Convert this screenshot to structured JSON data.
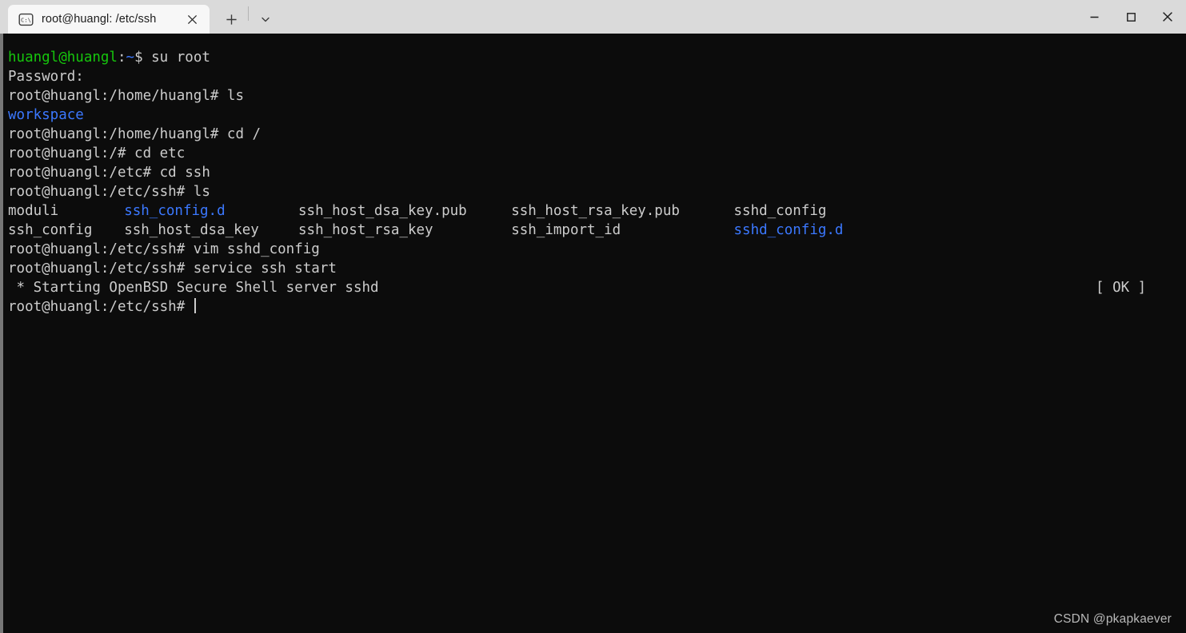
{
  "window": {
    "tab": {
      "title": "root@huangl: /etc/ssh",
      "icon": "command-prompt-icon",
      "close_label": "✕"
    },
    "newtab_label": "+",
    "dropdown_label": "⌄",
    "controls": {
      "minimize": "─",
      "maximize": "□",
      "close": "✕"
    },
    "titlebar_color": "#dadada",
    "tab_active_color": "#f7f7f7"
  },
  "terminal": {
    "background": "#0c0c0c",
    "foreground": "#cccccc",
    "green": "#16c60c",
    "blue": "#3b78ff",
    "lines": {
      "l1_user": "huangl@huangl",
      "l1_colon": ":",
      "l1_tilde": "~",
      "l1_dollar_cmd": "$ su root",
      "l2": "Password:",
      "l3": "root@huangl:/home/huangl# ls",
      "l4_workspace": "workspace",
      "l5": "root@huangl:/home/huangl# cd /",
      "l6": "root@huangl:/# cd etc",
      "l7": "root@huangl:/etc# cd ssh",
      "l8": "root@huangl:/etc/ssh# ls",
      "l11": "root@huangl:/etc/ssh# vim sshd_config",
      "l12": "root@huangl:/etc/ssh# service ssh start",
      "l13": " * Starting OpenBSD Secure Shell server sshd",
      "l13_status": "[ OK ]",
      "l14_prompt": "root@huangl:/etc/ssh# "
    },
    "ls_output": {
      "row1": [
        {
          "name": "moduli",
          "kind": "file",
          "col": 0
        },
        {
          "name": "ssh_config.d",
          "kind": "dir",
          "col": 12
        },
        {
          "name": "ssh_host_dsa_key.pub",
          "kind": "file",
          "col": 30
        },
        {
          "name": "ssh_host_rsa_key.pub",
          "kind": "file",
          "col": 52
        },
        {
          "name": "sshd_config",
          "kind": "file",
          "col": 75
        }
      ],
      "row2": [
        {
          "name": "ssh_config",
          "kind": "file",
          "col": 0
        },
        {
          "name": "ssh_host_dsa_key",
          "kind": "file",
          "col": 12
        },
        {
          "name": "ssh_host_rsa_key",
          "kind": "file",
          "col": 30
        },
        {
          "name": "ssh_import_id",
          "kind": "file",
          "col": 52
        },
        {
          "name": "sshd_config.d",
          "kind": "dir",
          "col": 75
        }
      ]
    }
  },
  "watermark": "CSDN @pkapkaever"
}
